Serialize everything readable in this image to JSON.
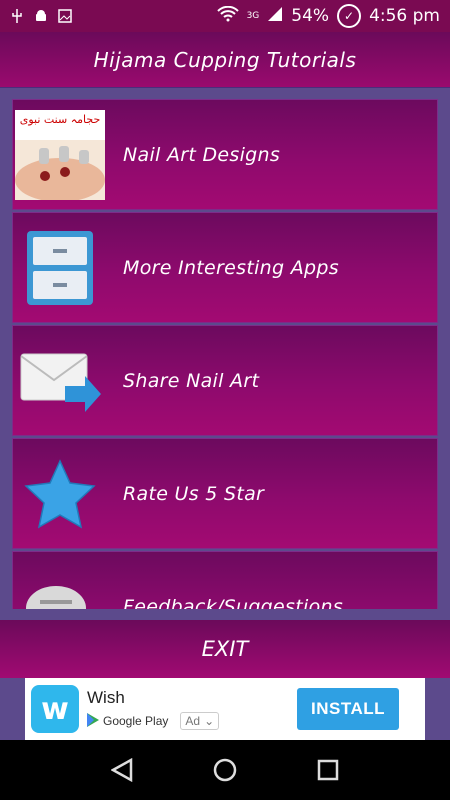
{
  "status_bar": {
    "network": "3G",
    "battery": "54%",
    "time": "4:56 pm"
  },
  "app_bar": {
    "title": "Hijama Cupping Tutorials"
  },
  "menu": {
    "items": [
      {
        "label": "Nail Art Designs",
        "icon": "hijama-thumbnail",
        "thumb_text": "حجامہ سنت نبوی"
      },
      {
        "label": "More Interesting Apps",
        "icon": "cabinet-icon"
      },
      {
        "label": "Share Nail Art",
        "icon": "share-envelope-icon"
      },
      {
        "label": "Rate Us 5 Star",
        "icon": "star-icon"
      },
      {
        "label": "Feedback/Suggestions",
        "icon": "chat-bubble-icon"
      }
    ]
  },
  "exit": {
    "label": "EXIT"
  },
  "ad": {
    "app_name": "Wish",
    "store": "Google Play",
    "badge": "Ad",
    "install_label": "INSTALL",
    "logo_letter": "w",
    "brand_color": "#2fb7ec"
  },
  "colors": {
    "bar_magenta": "#9a0a6e",
    "background_purple": "#5c4a8c",
    "install_blue": "#2fa0e3"
  }
}
